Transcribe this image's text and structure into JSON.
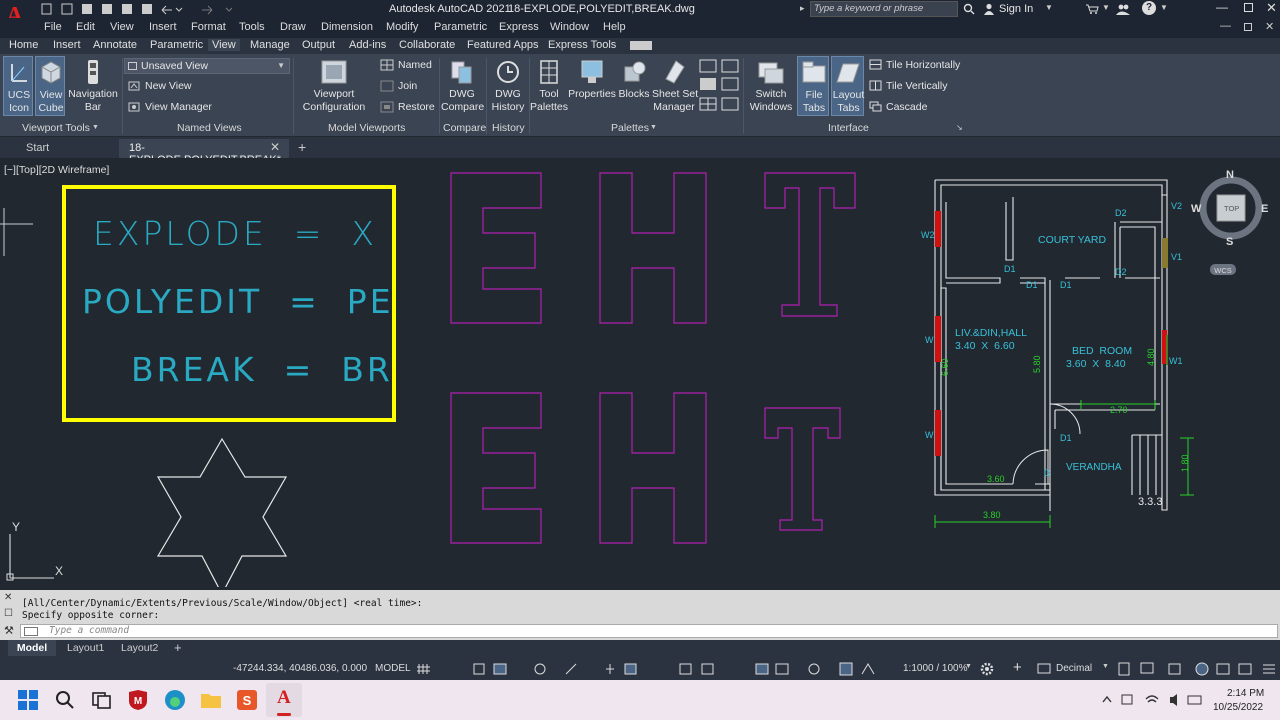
{
  "title_bar": {
    "app_title": "Autodesk AutoCAD 2021",
    "file_title": "18-EXPLODE,POLYEDIT,BREAK.dwg",
    "search_placeholder": "Type a keyword or phrase",
    "sign_in": "Sign In"
  },
  "menu": [
    "File",
    "Edit",
    "View",
    "Insert",
    "Format",
    "Tools",
    "Draw",
    "Dimension",
    "Modify",
    "Parametric",
    "Express",
    "Window",
    "Help"
  ],
  "ribbon_tabs": [
    "Home",
    "Insert",
    "Annotate",
    "Parametric",
    "View",
    "Manage",
    "Output",
    "Add-ins",
    "Collaborate",
    "Featured Apps",
    "Express Tools"
  ],
  "active_ribbon_tab": "View",
  "ribbon": {
    "viewport_tools": {
      "ucs_icon": "UCS\nIcon",
      "view_cube": "View\nCube",
      "navigation_bar": "Navigation\nBar",
      "title": "Viewport Tools"
    },
    "named_views": {
      "dropdown": "Unsaved View",
      "new_view": "New View",
      "view_manager": "View Manager",
      "title": "Named Views"
    },
    "model_viewports": {
      "viewport_config": "Viewport\nConfiguration",
      "named": "Named",
      "join": "Join",
      "restore": "Restore",
      "title": "Model Viewports"
    },
    "compare": {
      "dwg_compare": "DWG\nCompare",
      "title": "Compare"
    },
    "history": {
      "dwg_history": "DWG\nHistory",
      "title": "History"
    },
    "palettes": {
      "tool_palettes": "Tool\nPalettes",
      "properties": "Properties",
      "blocks": "Blocks",
      "sheet_set_manager": "Sheet Set\nManager",
      "title": "Palettes"
    },
    "interface": {
      "switch_windows": "Switch\nWindows",
      "file_tabs": "File\nTabs",
      "layout_tabs": "Layout\nTabs",
      "tile_horizontally": "Tile Horizontally",
      "tile_vertically": "Tile Vertically",
      "cascade": "Cascade",
      "title": "Interface"
    }
  },
  "file_tabs": {
    "start": "Start",
    "doc": "18-EXPLODE,POLYEDIT,BREAK*"
  },
  "viewport_label": "[−][Top][2D Wireframe]",
  "drawing": {
    "box_lines": [
      "EXPLODE  =  X",
      "POLYEDIT  =  PE",
      "BREAK  =  BR"
    ],
    "plan": {
      "court_yard": "COURT YARD",
      "liv_din_hall": "LIV.&DIN,HALL",
      "liv_size": "3.40  X  6.60",
      "bed_room": "BED  ROOM",
      "bed_size": "3.60  X  8.40",
      "verandha": "VERANDHA",
      "labels": {
        "w2": "W2",
        "d2a": "D2",
        "v2": "V2",
        "d1a": "D1",
        "d2b": "D2",
        "v1": "V1",
        "d1b": "D1",
        "d1c": "D1",
        "w_top": "W",
        "w1": "W1",
        "w_bot": "W",
        "d1d": "D1",
        "d": "D"
      },
      "dims": {
        "d660": "6.60",
        "d580": "5.80",
        "d480": "4.80",
        "d270": "2.70",
        "d180": "1.80",
        "d360": "3.60",
        "d380": "3.80",
        "d333": "3.3.3"
      }
    },
    "compass": {
      "n": "N",
      "s": "S",
      "e": "E",
      "w": "W",
      "top": "TOP",
      "wcs": "WCS"
    },
    "ucs": {
      "x": "X",
      "y": "Y"
    }
  },
  "command": {
    "history1": "[All/Center/Dynamic/Extents/Previous/Scale/Window/Object] <real time>:",
    "history2": "Specify opposite corner:",
    "placeholder": "Type a command"
  },
  "layout_tabs": [
    "Model",
    "Layout1",
    "Layout2"
  ],
  "status": {
    "coords": "-47244.334, 40486.036, 0.000",
    "model": "MODEL",
    "scale": "1:1000 / 100%",
    "units": "Decimal"
  },
  "taskbar": {
    "time": "2:14 PM",
    "date": "10/25/2022"
  },
  "colors": {
    "yellow_box": "#ffff00",
    "cyan_text": "#2aa9c2",
    "magenta": "#b020b0",
    "plan_white": "#e8e8e8",
    "plan_cyan": "#38c0d8",
    "dim_green": "#28d028",
    "window_red": "#d21010"
  }
}
